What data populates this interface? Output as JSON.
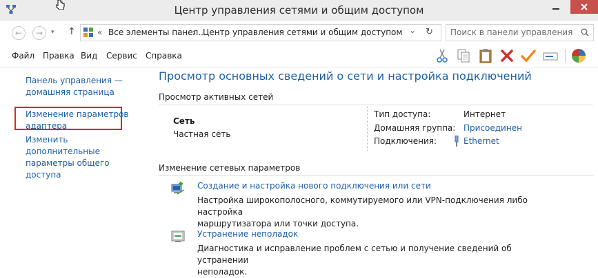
{
  "window": {
    "title": "Центр управления сетями и общим доступом"
  },
  "address_bar": {
    "back_glyph": "←",
    "forward_glyph": "→",
    "up_glyph": "↑",
    "path_prefix": "«",
    "segments": [
      "Все элементы панел...",
      "Центр управления сетями и общим доступом"
    ],
    "separator": "›",
    "dropdown_glyph": "⌄",
    "refresh_glyph": "↻"
  },
  "search": {
    "placeholder": "Поиск в панели управления"
  },
  "menu": {
    "items": [
      "Файл",
      "Правка",
      "Вид",
      "Сервис",
      "Справка"
    ]
  },
  "toolbar": {
    "icons": [
      "cut-icon",
      "copy-icon",
      "paste-icon",
      "delete-icon",
      "check-icon",
      "rename-icon",
      "control-panel-icon"
    ]
  },
  "sidebar": {
    "home_link_line1": "Панель управления —",
    "home_link_line2": "домашняя страница",
    "adapter_link_line1": "Изменение параметров",
    "adapter_link_line2": "адаптера",
    "sharing_link_line1": "Изменить дополнительные",
    "sharing_link_line2": "параметры общего доступа"
  },
  "main": {
    "title": "Просмотр основных сведений о сети и настройка подключений",
    "active_networks_title": "Просмотр активных сетей",
    "network": {
      "name": "Сеть",
      "type": "Частная сеть"
    },
    "properties": {
      "access_type_label": "Тип доступа:",
      "access_type_value": "Интернет",
      "homegroup_label": "Домашняя группа:",
      "homegroup_value": "Присоединен",
      "connections_label": "Подключения:",
      "connections_value": "Ethernet"
    },
    "change_settings_title": "Изменение сетевых параметров",
    "tasks": [
      {
        "link": "Создание и настройка нового подключения или сети",
        "desc_line1": "Настройка широкополосного, коммутируемого или VPN-подключения либо настройка",
        "desc_line2": "маршрутизатора или точки доступа."
      },
      {
        "link": "Устранение неполадок",
        "desc_line1": "Диагностика и исправление проблем с сетью и получение сведений об устранении",
        "desc_line2": "неполадок."
      }
    ]
  },
  "colors": {
    "link": "#1c5fa8",
    "highlight_border": "#d52b1e",
    "close_button": "#c7504a"
  }
}
